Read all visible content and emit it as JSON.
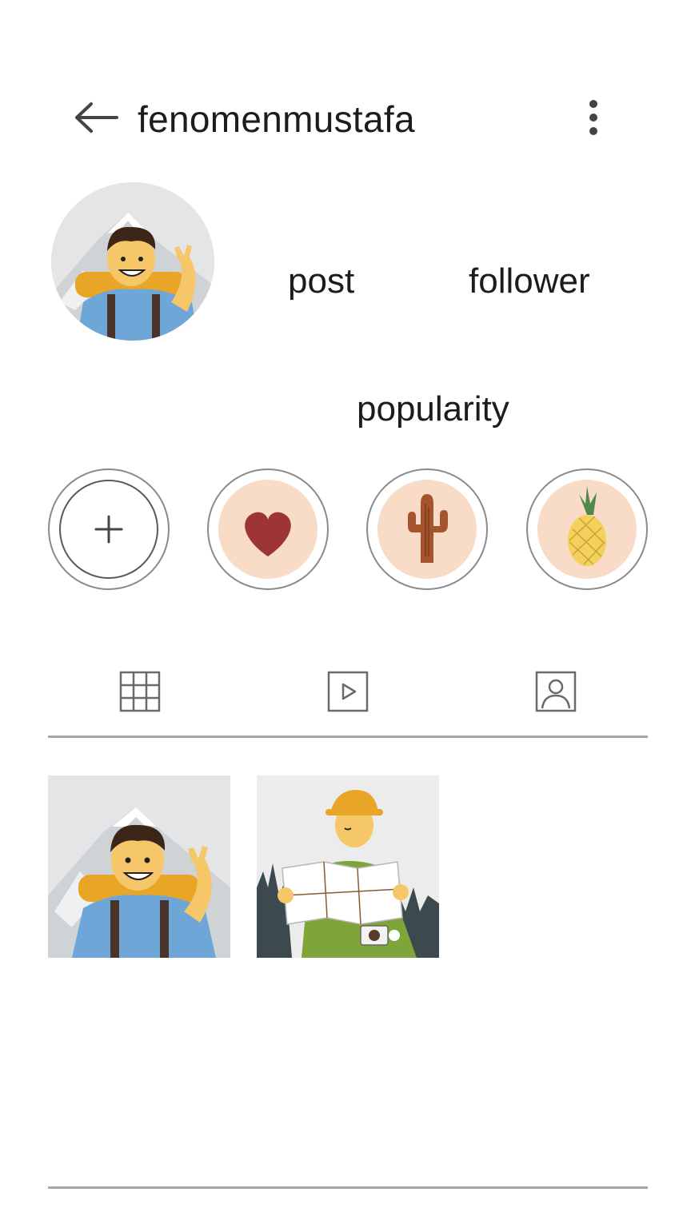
{
  "header": {
    "username": "fenomenmustafa",
    "back_icon": "arrow-left-icon",
    "more_icon": "vertical-dots-icon"
  },
  "profile": {
    "avatar_icon": "hiker-avatar",
    "stats": {
      "post_label": "post",
      "follower_label": "follower",
      "popularity_label": "popularity"
    }
  },
  "highlights": [
    {
      "icon": "plus-icon"
    },
    {
      "icon": "heart-icon"
    },
    {
      "icon": "cactus-icon"
    },
    {
      "icon": "pineapple-icon"
    }
  ],
  "tabs": [
    {
      "icon": "grid-icon"
    },
    {
      "icon": "reels-icon"
    },
    {
      "icon": "tagged-icon"
    }
  ],
  "posts": [
    {
      "icon": "hiker-image"
    },
    {
      "icon": "traveler-map-image"
    }
  ],
  "colors": {
    "highlight_fill": "#f8dcc7",
    "heart": "#9e3535",
    "cactus": "#a5552d",
    "pineapple": "#f3d15c",
    "shirt_green": "#7fa43a",
    "skin": "#f6c768",
    "divider": "#a6a6a6"
  }
}
